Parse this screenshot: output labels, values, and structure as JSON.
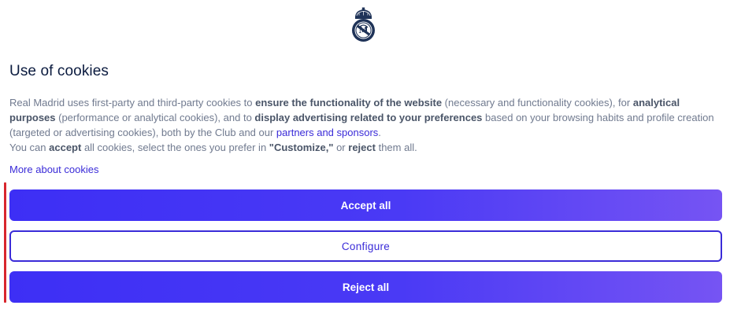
{
  "logo": {
    "icon": "real-madrid-crest-icon",
    "color": "#1f3358"
  },
  "dialog": {
    "title": "Use of cookies",
    "paragraph": {
      "t1": "Real Madrid uses first-party and third-party cookies to ",
      "b1": "ensure the functionality of the website",
      "t2": " (necessary and functionality cookies), for ",
      "b2": "analytical purposes",
      "t3": " (performance or analytical cookies), and to ",
      "b3": "display advertising related to your preferences",
      "t4": " based on your browsing habits and profile creation (targeted or advertising cookies), both by the Club and our ",
      "link": "partners and sponsors",
      "t5": ".",
      "t6": "You can ",
      "b4": "accept",
      "t7": " all cookies, select the ones you prefer in ",
      "b5": "\"Customize,\"",
      "t8": " or ",
      "b6": "reject",
      "t9": " them all."
    },
    "more_link": "More about cookies"
  },
  "buttons": {
    "accept": "Accept all",
    "configure": "Configure",
    "reject": "Reject all"
  },
  "colors": {
    "accent": "#3a2bd8",
    "gradient_start": "#3d2ff5",
    "gradient_end": "#7654f3",
    "focus_indicator": "#d8262d",
    "title": "#0b1b3f",
    "body_text": "#707a8f"
  }
}
